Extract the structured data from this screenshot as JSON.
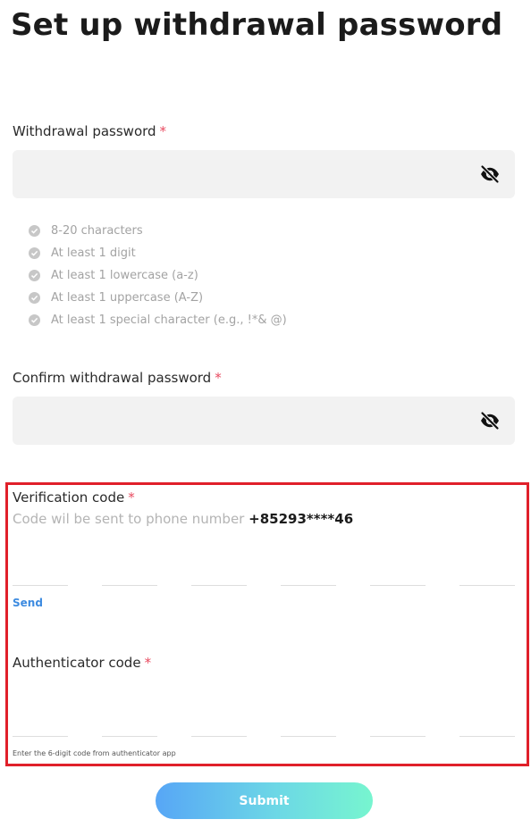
{
  "page": {
    "title": "Set up withdrawal password"
  },
  "withdrawal_password": {
    "label": "Withdrawal password",
    "required_mark": "*",
    "value": "",
    "toggle_icon": "eye-slash-icon"
  },
  "password_rules": [
    {
      "text": "8-20 characters",
      "met": false
    },
    {
      "text": "At least 1 digit",
      "met": false
    },
    {
      "text": "At least 1 lowercase (a-z)",
      "met": false
    },
    {
      "text": "At least 1 uppercase (A-Z)",
      "met": false
    },
    {
      "text": "At least 1 special character (e.g., !*& @)",
      "met": false
    }
  ],
  "confirm_password": {
    "label": "Confirm withdrawal password",
    "required_mark": "*",
    "value": "",
    "toggle_icon": "eye-slash-icon"
  },
  "verification_code": {
    "label": "Verification code",
    "required_mark": "*",
    "hint_prefix": "Code wil be sent to phone number",
    "phone": "+85293****46",
    "digits": [
      "",
      "",
      "",
      "",
      "",
      ""
    ],
    "send_label": "Send"
  },
  "authenticator_code": {
    "label": "Authenticator code",
    "required_mark": "*",
    "digits": [
      "",
      "",
      "",
      "",
      "",
      ""
    ],
    "hint": "Enter the 6-digit code from authenticator app"
  },
  "submit": {
    "label": "Submit"
  },
  "colors": {
    "required": "#e84a5f",
    "link": "#3d8be0",
    "highlight_border": "#e0202a",
    "submit_gradient_start": "#57a6f6",
    "submit_gradient_end": "#77f5cf"
  }
}
